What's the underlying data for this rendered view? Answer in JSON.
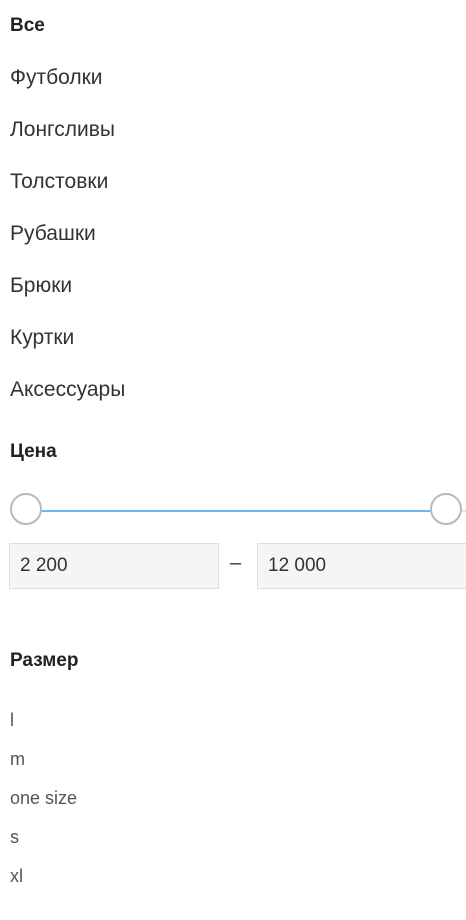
{
  "categories": {
    "items": [
      {
        "label": "Все",
        "active": true
      },
      {
        "label": "Футболки"
      },
      {
        "label": "Лонгсливы"
      },
      {
        "label": "Толстовки"
      },
      {
        "label": "Рубашки"
      },
      {
        "label": "Брюки"
      },
      {
        "label": "Куртки"
      },
      {
        "label": "Аксессуары"
      }
    ]
  },
  "price": {
    "title": "Цена",
    "min_value": "2 200",
    "max_value": "12 000",
    "separator": "–",
    "slider": {
      "min_fraction": 0.0,
      "max_fraction": 1.0
    },
    "accent_color": "#6fb6f0"
  },
  "size": {
    "title": "Размер",
    "items": [
      "l",
      "m",
      "one size",
      "s",
      "xl"
    ]
  }
}
